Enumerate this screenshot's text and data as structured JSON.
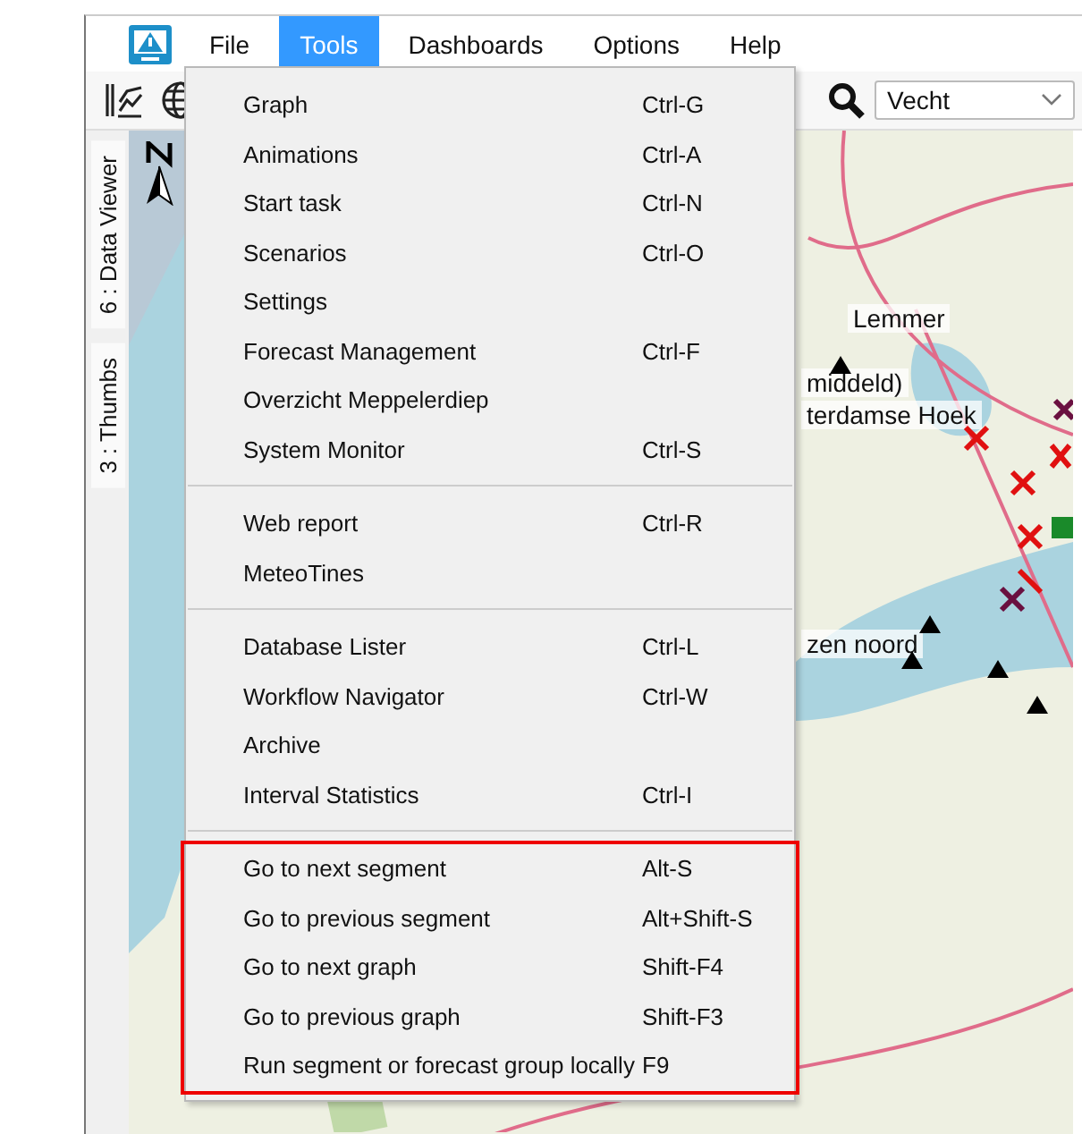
{
  "menu_bar": [
    {
      "label": "File",
      "selected": false
    },
    {
      "label": "Tools",
      "selected": true
    },
    {
      "label": "Dashboards",
      "selected": false
    },
    {
      "label": "Options",
      "selected": false
    },
    {
      "label": "Help",
      "selected": false
    }
  ],
  "toolbar": {
    "location_combo": {
      "value": "Vecht"
    }
  },
  "side_tabs": [
    {
      "label": "6 : Data Viewer"
    },
    {
      "label": "3 : Thumbs"
    }
  ],
  "map": {
    "labels": [
      {
        "text": "Lemmer"
      },
      {
        "text": "middeld)"
      },
      {
        "text": "terdamse Hoek"
      },
      {
        "text": "zen noord"
      }
    ]
  },
  "tools_menu": {
    "groups": [
      {
        "highlighted": false,
        "items": [
          {
            "label": "Graph",
            "shortcut": "Ctrl-G"
          },
          {
            "label": "Animations",
            "shortcut": "Ctrl-A"
          },
          {
            "label": "Start task",
            "shortcut": "Ctrl-N"
          },
          {
            "label": "Scenarios",
            "shortcut": "Ctrl-O"
          },
          {
            "label": "Settings"
          },
          {
            "label": "Forecast Management",
            "shortcut": "Ctrl-F"
          },
          {
            "label": "Overzicht Meppelerdiep"
          },
          {
            "label": "System Monitor",
            "shortcut": "Ctrl-S"
          }
        ]
      },
      {
        "highlighted": false,
        "items": [
          {
            "label": "Web report",
            "shortcut": "Ctrl-R"
          },
          {
            "label": "MeteoTines"
          }
        ]
      },
      {
        "highlighted": false,
        "items": [
          {
            "label": "Database Lister",
            "shortcut": "Ctrl-L"
          },
          {
            "label": "Workflow Navigator",
            "shortcut": "Ctrl-W"
          },
          {
            "label": "Archive"
          },
          {
            "label": "Interval Statistics",
            "shortcut": "Ctrl-I"
          }
        ]
      },
      {
        "highlighted": true,
        "items": [
          {
            "label": "Go to next segment",
            "shortcut": "Alt-S"
          },
          {
            "label": "Go to previous segment",
            "shortcut": "Alt+Shift-S"
          },
          {
            "label": "Go to next graph",
            "shortcut": "Shift-F4"
          },
          {
            "label": "Go to previous graph",
            "shortcut": "Shift-F3"
          },
          {
            "label": "Run segment or forecast group locally",
            "shortcut": "F9"
          }
        ]
      }
    ]
  }
}
